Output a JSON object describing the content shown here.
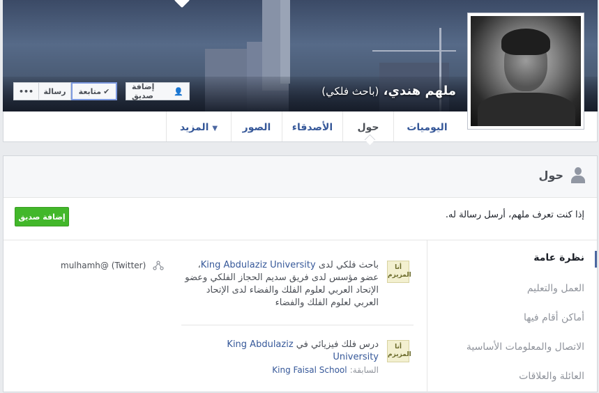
{
  "cover": {
    "profile_name": "ملهم هندي،",
    "profile_subtitle": "(باحث فلكي)"
  },
  "actions": {
    "more_label": "•••",
    "message_label": "رسالة",
    "follow_label": "متابعة",
    "add_friend_label": "إضافة صديق"
  },
  "nav": {
    "timeline": "اليوميات",
    "about": "حول",
    "friends": "الأصدقاء",
    "photos": "الصور",
    "more": "المزيد"
  },
  "about": {
    "title": "حول",
    "cta_text": "إذا كنت تعرف ملهم، أرسل رسالة له.",
    "add_friend_button": "إضافة صديق"
  },
  "sidebar": {
    "items": [
      {
        "label": "نظرة عامة"
      },
      {
        "label": "العمل والتعليم"
      },
      {
        "label": "أماكن أقام فيها"
      },
      {
        "label": "الاتصال والمعلومات الأساسية"
      },
      {
        "label": "العائلة والعلاقات"
      }
    ]
  },
  "overview": {
    "work_icon_text": "أنا المزيزم",
    "work_prefix": "باحث فلكي لدى",
    "work_org": "King Abdulaziz University",
    "work_rest": "، عضو مؤسس لدى فريق سديم الحجاز الفلكي وعضو الإتحاد العربي لعلوم الفلك والفضاء لدى الإتحاد العربي لعلوم الفلك والفضاء",
    "edu_icon_text": "أنا المزيزم",
    "edu_prefix": "درس فلك فيزيائي في",
    "edu_org": "King Abdulaziz University",
    "edu_previous_label": "السابقة:",
    "edu_previous_value": "King Faisal School",
    "twitter_text": "mulhamh@ (Twitter)"
  }
}
